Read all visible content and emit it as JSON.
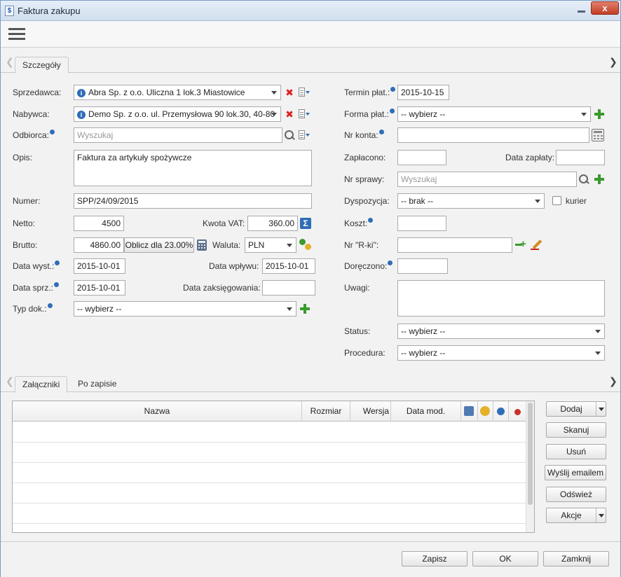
{
  "window": {
    "title": "Faktura zakupu",
    "close_label": "x"
  },
  "tabs_top": [
    {
      "label": "Szczegóły"
    }
  ],
  "tabs_bottom": [
    {
      "label": "Załączniki"
    },
    {
      "label": "Po zapisie"
    }
  ],
  "left": {
    "sprzedawca": {
      "label": "Sprzedawca:",
      "value": "Abra Sp. z o.o. Uliczna 1 lok.3 Miastowice"
    },
    "nabywca": {
      "label": "Nabywca:",
      "value": "Demo Sp. z o.o. ul. Przemysłowa 90 lok.30, 40-80"
    },
    "odbiorca": {
      "label": "Odbiorca:",
      "placeholder": "Wyszukaj"
    },
    "opis": {
      "label": "Opis:",
      "value": "Faktura za artykuły spożywcze"
    },
    "numer": {
      "label": "Numer:",
      "value": "SPP/24/09/2015"
    },
    "netto": {
      "label": "Netto:",
      "value": "4500"
    },
    "kwota_vat": {
      "label": "Kwota VAT:",
      "value": "360.00"
    },
    "brutto": {
      "label": "Brutto:",
      "value": "4860.00"
    },
    "oblicz": {
      "label": "Oblicz dla 23.00%"
    },
    "waluta": {
      "label": "Waluta:",
      "value": "PLN"
    },
    "data_wyst": {
      "label": "Data wyst.:",
      "value": "2015-10-01"
    },
    "data_wplywu": {
      "label": "Data wpływu:",
      "value": "2015-10-01"
    },
    "data_sprz": {
      "label": "Data sprz.:",
      "value": "2015-10-01"
    },
    "data_zaksiegowania": {
      "label": "Data zaksięgowania:",
      "value": ""
    },
    "typ_dok": {
      "label": "Typ dok.:",
      "value": "-- wybierz --"
    }
  },
  "right": {
    "termin_plat": {
      "label": "Termin płat.:",
      "value": "2015-10-15"
    },
    "forma_plat": {
      "label": "Forma płat.:",
      "value": "-- wybierz --"
    },
    "nr_konta": {
      "label": "Nr konta:",
      "value": ""
    },
    "zaplacono": {
      "label": "Zapłacono:",
      "value": ""
    },
    "data_zaplaty": {
      "label": "Data zapłaty:",
      "value": ""
    },
    "nr_sprawy": {
      "label": "Nr sprawy:",
      "placeholder": "Wyszukaj"
    },
    "dyspozycja": {
      "label": "Dyspozycja:",
      "value": "-- brak --"
    },
    "kurier": {
      "label": "kurier"
    },
    "koszt": {
      "label": "Koszt:",
      "value": ""
    },
    "nr_rki": {
      "label": "Nr \"R-ki\":",
      "value": ""
    },
    "doreczono": {
      "label": "Doręczono:",
      "value": ""
    },
    "uwagi": {
      "label": "Uwagi:",
      "value": ""
    },
    "status": {
      "label": "Status:",
      "value": "-- wybierz --"
    },
    "procedura": {
      "label": "Procedura:",
      "value": "-- wybierz --"
    }
  },
  "attachments": {
    "columns": [
      "Nazwa",
      "Rozmiar",
      "Wersja",
      "Data mod."
    ],
    "rows": 5
  },
  "side_buttons": {
    "dodaj": "Dodaj",
    "skanuj": "Skanuj",
    "usun": "Usuń",
    "wyslij": "Wyślij emailem",
    "odswiez": "Odśwież",
    "akcje": "Akcje"
  },
  "footer": {
    "zapisz": "Zapisz",
    "ok": "OK",
    "zamknij": "Zamknij"
  },
  "icons": {
    "info": "info-icon",
    "delete": "delete-x-icon",
    "menu": "doc-menu-icon",
    "add": "green-plus-icon",
    "search": "search-icon"
  },
  "colors": {
    "accent": "#2f6db8",
    "delete": "#dd2222",
    "add": "#3a9a2c"
  }
}
